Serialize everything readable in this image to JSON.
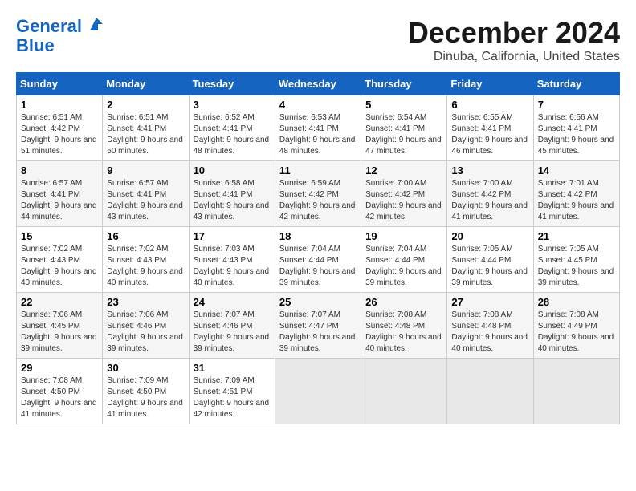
{
  "logo": {
    "line1": "General",
    "line2": "Blue"
  },
  "title": "December 2024",
  "location": "Dinuba, California, United States",
  "days_of_week": [
    "Sunday",
    "Monday",
    "Tuesday",
    "Wednesday",
    "Thursday",
    "Friday",
    "Saturday"
  ],
  "weeks": [
    [
      {
        "day": "1",
        "sunrise": "6:51 AM",
        "sunset": "4:42 PM",
        "daylight": "9 hours and 51 minutes."
      },
      {
        "day": "2",
        "sunrise": "6:51 AM",
        "sunset": "4:41 PM",
        "daylight": "9 hours and 50 minutes."
      },
      {
        "day": "3",
        "sunrise": "6:52 AM",
        "sunset": "4:41 PM",
        "daylight": "9 hours and 48 minutes."
      },
      {
        "day": "4",
        "sunrise": "6:53 AM",
        "sunset": "4:41 PM",
        "daylight": "9 hours and 48 minutes."
      },
      {
        "day": "5",
        "sunrise": "6:54 AM",
        "sunset": "4:41 PM",
        "daylight": "9 hours and 47 minutes."
      },
      {
        "day": "6",
        "sunrise": "6:55 AM",
        "sunset": "4:41 PM",
        "daylight": "9 hours and 46 minutes."
      },
      {
        "day": "7",
        "sunrise": "6:56 AM",
        "sunset": "4:41 PM",
        "daylight": "9 hours and 45 minutes."
      }
    ],
    [
      {
        "day": "8",
        "sunrise": "6:57 AM",
        "sunset": "4:41 PM",
        "daylight": "9 hours and 44 minutes."
      },
      {
        "day": "9",
        "sunrise": "6:57 AM",
        "sunset": "4:41 PM",
        "daylight": "9 hours and 43 minutes."
      },
      {
        "day": "10",
        "sunrise": "6:58 AM",
        "sunset": "4:41 PM",
        "daylight": "9 hours and 43 minutes."
      },
      {
        "day": "11",
        "sunrise": "6:59 AM",
        "sunset": "4:42 PM",
        "daylight": "9 hours and 42 minutes."
      },
      {
        "day": "12",
        "sunrise": "7:00 AM",
        "sunset": "4:42 PM",
        "daylight": "9 hours and 42 minutes."
      },
      {
        "day": "13",
        "sunrise": "7:00 AM",
        "sunset": "4:42 PM",
        "daylight": "9 hours and 41 minutes."
      },
      {
        "day": "14",
        "sunrise": "7:01 AM",
        "sunset": "4:42 PM",
        "daylight": "9 hours and 41 minutes."
      }
    ],
    [
      {
        "day": "15",
        "sunrise": "7:02 AM",
        "sunset": "4:43 PM",
        "daylight": "9 hours and 40 minutes."
      },
      {
        "day": "16",
        "sunrise": "7:02 AM",
        "sunset": "4:43 PM",
        "daylight": "9 hours and 40 minutes."
      },
      {
        "day": "17",
        "sunrise": "7:03 AM",
        "sunset": "4:43 PM",
        "daylight": "9 hours and 40 minutes."
      },
      {
        "day": "18",
        "sunrise": "7:04 AM",
        "sunset": "4:44 PM",
        "daylight": "9 hours and 39 minutes."
      },
      {
        "day": "19",
        "sunrise": "7:04 AM",
        "sunset": "4:44 PM",
        "daylight": "9 hours and 39 minutes."
      },
      {
        "day": "20",
        "sunrise": "7:05 AM",
        "sunset": "4:44 PM",
        "daylight": "9 hours and 39 minutes."
      },
      {
        "day": "21",
        "sunrise": "7:05 AM",
        "sunset": "4:45 PM",
        "daylight": "9 hours and 39 minutes."
      }
    ],
    [
      {
        "day": "22",
        "sunrise": "7:06 AM",
        "sunset": "4:45 PM",
        "daylight": "9 hours and 39 minutes."
      },
      {
        "day": "23",
        "sunrise": "7:06 AM",
        "sunset": "4:46 PM",
        "daylight": "9 hours and 39 minutes."
      },
      {
        "day": "24",
        "sunrise": "7:07 AM",
        "sunset": "4:46 PM",
        "daylight": "9 hours and 39 minutes."
      },
      {
        "day": "25",
        "sunrise": "7:07 AM",
        "sunset": "4:47 PM",
        "daylight": "9 hours and 39 minutes."
      },
      {
        "day": "26",
        "sunrise": "7:08 AM",
        "sunset": "4:48 PM",
        "daylight": "9 hours and 40 minutes."
      },
      {
        "day": "27",
        "sunrise": "7:08 AM",
        "sunset": "4:48 PM",
        "daylight": "9 hours and 40 minutes."
      },
      {
        "day": "28",
        "sunrise": "7:08 AM",
        "sunset": "4:49 PM",
        "daylight": "9 hours and 40 minutes."
      }
    ],
    [
      {
        "day": "29",
        "sunrise": "7:08 AM",
        "sunset": "4:50 PM",
        "daylight": "9 hours and 41 minutes."
      },
      {
        "day": "30",
        "sunrise": "7:09 AM",
        "sunset": "4:50 PM",
        "daylight": "9 hours and 41 minutes."
      },
      {
        "day": "31",
        "sunrise": "7:09 AM",
        "sunset": "4:51 PM",
        "daylight": "9 hours and 42 minutes."
      },
      null,
      null,
      null,
      null
    ]
  ]
}
